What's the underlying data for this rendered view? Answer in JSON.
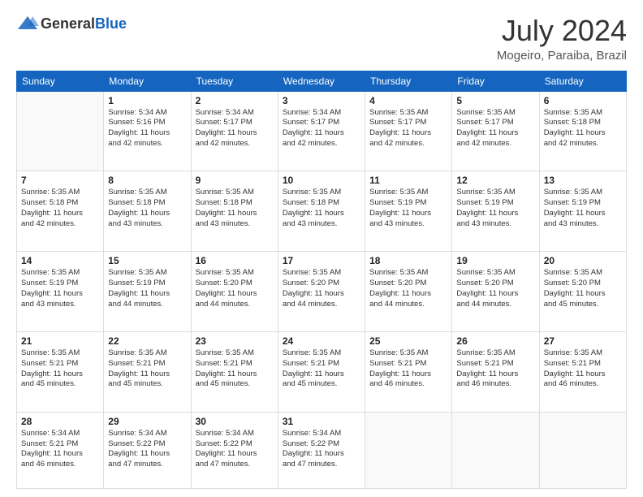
{
  "header": {
    "logo_general": "General",
    "logo_blue": "Blue",
    "month_year": "July 2024",
    "location": "Mogeiro, Paraiba, Brazil"
  },
  "weekdays": [
    "Sunday",
    "Monday",
    "Tuesday",
    "Wednesday",
    "Thursday",
    "Friday",
    "Saturday"
  ],
  "weeks": [
    [
      {
        "day": "",
        "info": ""
      },
      {
        "day": "1",
        "info": "Sunrise: 5:34 AM\nSunset: 5:16 PM\nDaylight: 11 hours\nand 42 minutes."
      },
      {
        "day": "2",
        "info": "Sunrise: 5:34 AM\nSunset: 5:17 PM\nDaylight: 11 hours\nand 42 minutes."
      },
      {
        "day": "3",
        "info": "Sunrise: 5:34 AM\nSunset: 5:17 PM\nDaylight: 11 hours\nand 42 minutes."
      },
      {
        "day": "4",
        "info": "Sunrise: 5:35 AM\nSunset: 5:17 PM\nDaylight: 11 hours\nand 42 minutes."
      },
      {
        "day": "5",
        "info": "Sunrise: 5:35 AM\nSunset: 5:17 PM\nDaylight: 11 hours\nand 42 minutes."
      },
      {
        "day": "6",
        "info": "Sunrise: 5:35 AM\nSunset: 5:18 PM\nDaylight: 11 hours\nand 42 minutes."
      }
    ],
    [
      {
        "day": "7",
        "info": "Sunrise: 5:35 AM\nSunset: 5:18 PM\nDaylight: 11 hours\nand 42 minutes."
      },
      {
        "day": "8",
        "info": "Sunrise: 5:35 AM\nSunset: 5:18 PM\nDaylight: 11 hours\nand 43 minutes."
      },
      {
        "day": "9",
        "info": "Sunrise: 5:35 AM\nSunset: 5:18 PM\nDaylight: 11 hours\nand 43 minutes."
      },
      {
        "day": "10",
        "info": "Sunrise: 5:35 AM\nSunset: 5:18 PM\nDaylight: 11 hours\nand 43 minutes."
      },
      {
        "day": "11",
        "info": "Sunrise: 5:35 AM\nSunset: 5:19 PM\nDaylight: 11 hours\nand 43 minutes."
      },
      {
        "day": "12",
        "info": "Sunrise: 5:35 AM\nSunset: 5:19 PM\nDaylight: 11 hours\nand 43 minutes."
      },
      {
        "day": "13",
        "info": "Sunrise: 5:35 AM\nSunset: 5:19 PM\nDaylight: 11 hours\nand 43 minutes."
      }
    ],
    [
      {
        "day": "14",
        "info": "Sunrise: 5:35 AM\nSunset: 5:19 PM\nDaylight: 11 hours\nand 43 minutes."
      },
      {
        "day": "15",
        "info": "Sunrise: 5:35 AM\nSunset: 5:19 PM\nDaylight: 11 hours\nand 44 minutes."
      },
      {
        "day": "16",
        "info": "Sunrise: 5:35 AM\nSunset: 5:20 PM\nDaylight: 11 hours\nand 44 minutes."
      },
      {
        "day": "17",
        "info": "Sunrise: 5:35 AM\nSunset: 5:20 PM\nDaylight: 11 hours\nand 44 minutes."
      },
      {
        "day": "18",
        "info": "Sunrise: 5:35 AM\nSunset: 5:20 PM\nDaylight: 11 hours\nand 44 minutes."
      },
      {
        "day": "19",
        "info": "Sunrise: 5:35 AM\nSunset: 5:20 PM\nDaylight: 11 hours\nand 44 minutes."
      },
      {
        "day": "20",
        "info": "Sunrise: 5:35 AM\nSunset: 5:20 PM\nDaylight: 11 hours\nand 45 minutes."
      }
    ],
    [
      {
        "day": "21",
        "info": "Sunrise: 5:35 AM\nSunset: 5:21 PM\nDaylight: 11 hours\nand 45 minutes."
      },
      {
        "day": "22",
        "info": "Sunrise: 5:35 AM\nSunset: 5:21 PM\nDaylight: 11 hours\nand 45 minutes."
      },
      {
        "day": "23",
        "info": "Sunrise: 5:35 AM\nSunset: 5:21 PM\nDaylight: 11 hours\nand 45 minutes."
      },
      {
        "day": "24",
        "info": "Sunrise: 5:35 AM\nSunset: 5:21 PM\nDaylight: 11 hours\nand 45 minutes."
      },
      {
        "day": "25",
        "info": "Sunrise: 5:35 AM\nSunset: 5:21 PM\nDaylight: 11 hours\nand 46 minutes."
      },
      {
        "day": "26",
        "info": "Sunrise: 5:35 AM\nSunset: 5:21 PM\nDaylight: 11 hours\nand 46 minutes."
      },
      {
        "day": "27",
        "info": "Sunrise: 5:35 AM\nSunset: 5:21 PM\nDaylight: 11 hours\nand 46 minutes."
      }
    ],
    [
      {
        "day": "28",
        "info": "Sunrise: 5:34 AM\nSunset: 5:21 PM\nDaylight: 11 hours\nand 46 minutes."
      },
      {
        "day": "29",
        "info": "Sunrise: 5:34 AM\nSunset: 5:22 PM\nDaylight: 11 hours\nand 47 minutes."
      },
      {
        "day": "30",
        "info": "Sunrise: 5:34 AM\nSunset: 5:22 PM\nDaylight: 11 hours\nand 47 minutes."
      },
      {
        "day": "31",
        "info": "Sunrise: 5:34 AM\nSunset: 5:22 PM\nDaylight: 11 hours\nand 47 minutes."
      },
      {
        "day": "",
        "info": ""
      },
      {
        "day": "",
        "info": ""
      },
      {
        "day": "",
        "info": ""
      }
    ]
  ]
}
